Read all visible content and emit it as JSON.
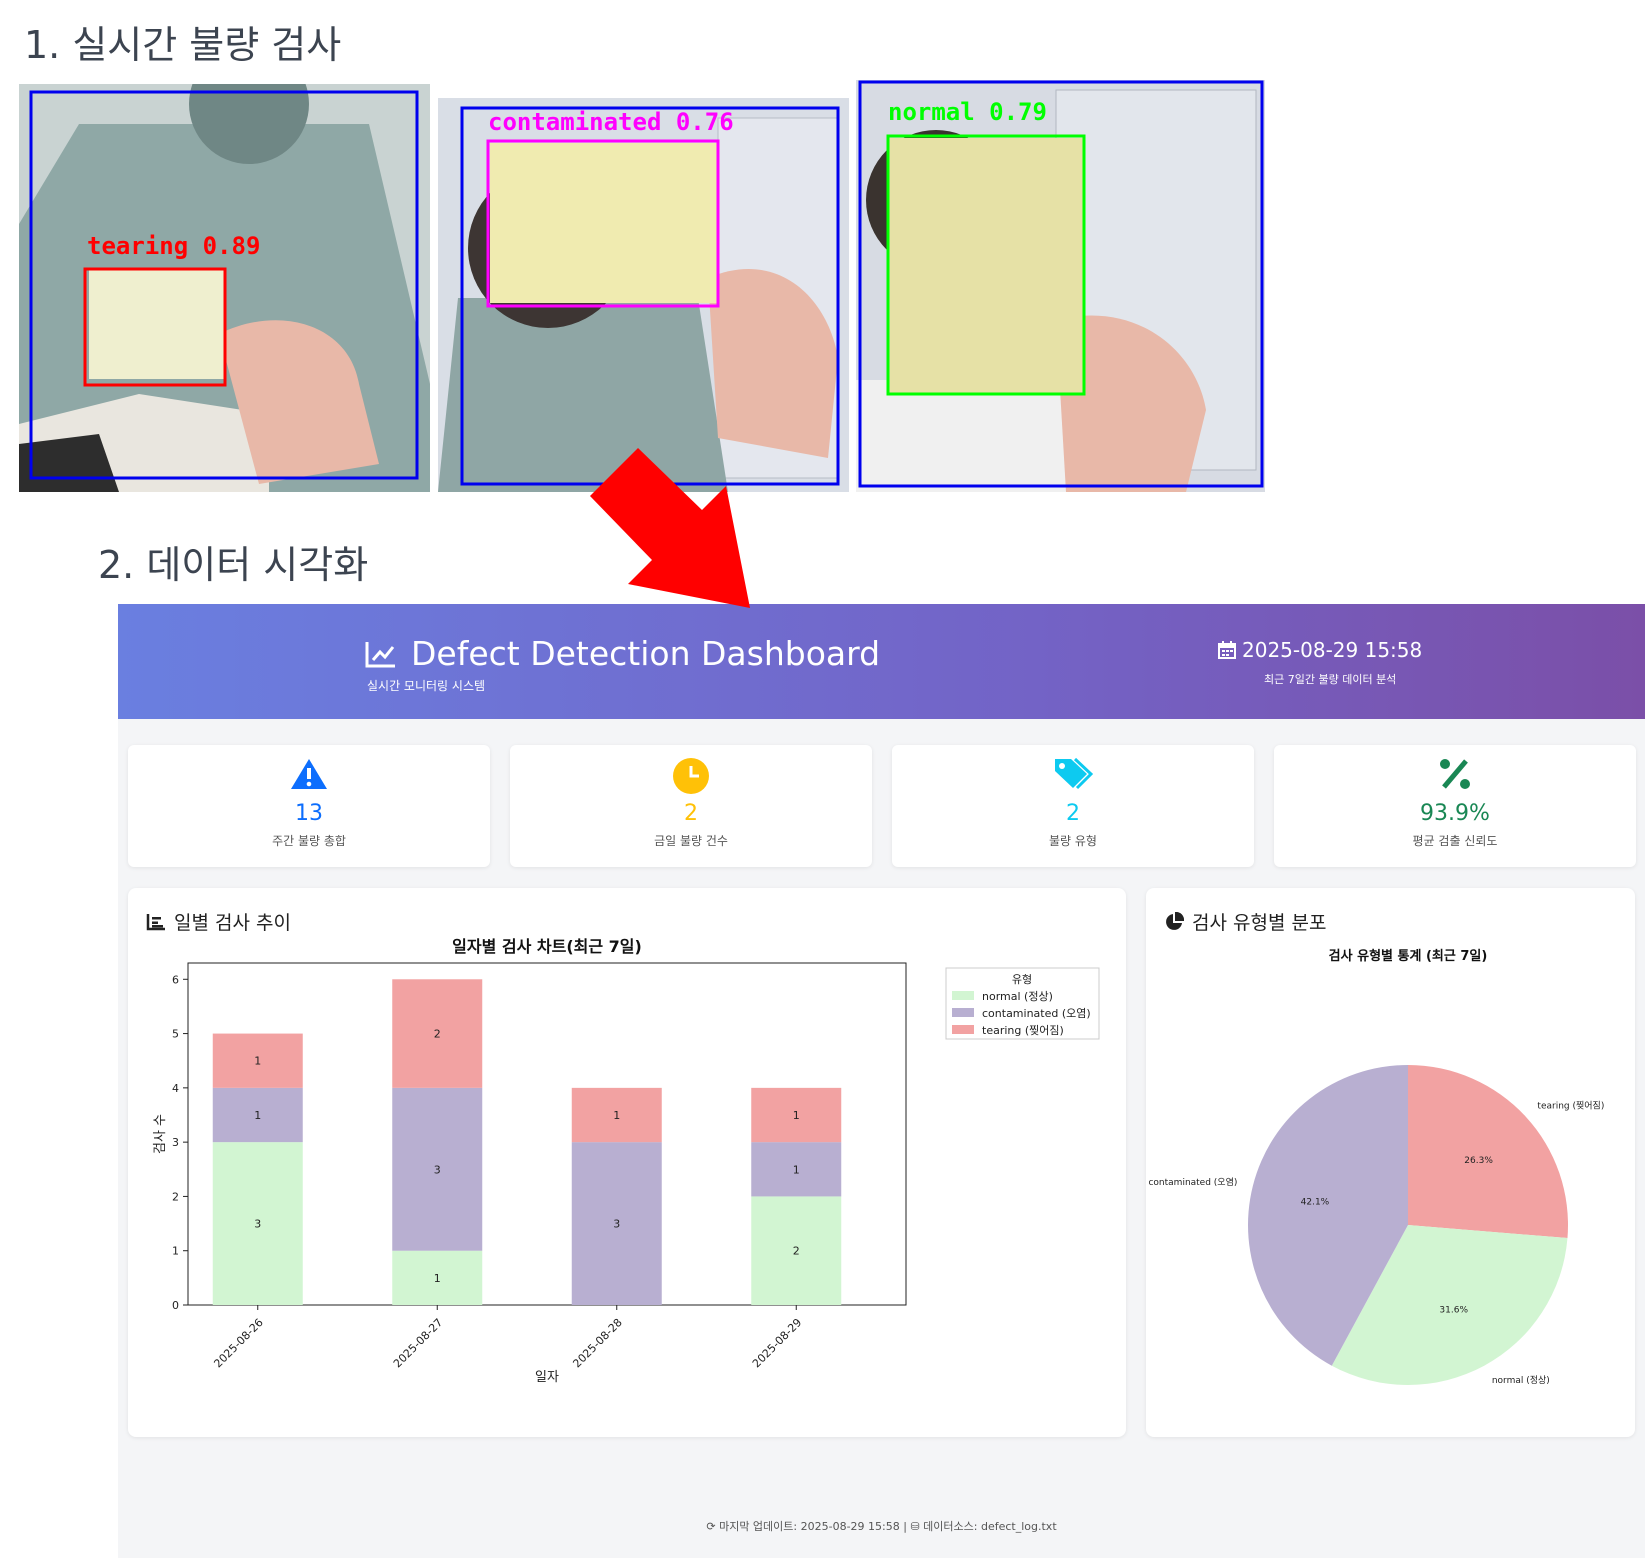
{
  "sections": {
    "realtime_title": "1. 실시간 불량 검사",
    "viz_title": "2. 데이터 시각화"
  },
  "detections": [
    {
      "label": "tearing 0.89",
      "color": "#ff0000"
    },
    {
      "label": "contaminated 0.76",
      "color": "#ff00ff"
    },
    {
      "label": "normal 0.79",
      "color": "#00ff00"
    }
  ],
  "header": {
    "title": "Defect Detection Dashboard",
    "subtitle": "실시간 모니터링 시스템",
    "datetime": "2025-08-29 15:58",
    "note": "최근 7일간 불량 데이터 분석"
  },
  "stats": [
    {
      "value": "13",
      "label": "주간 불량 총합",
      "color": "#0d6efd",
      "icon": "warning-icon"
    },
    {
      "value": "2",
      "label": "금일 불량 건수",
      "color": "#ffc107",
      "icon": "clock-icon"
    },
    {
      "value": "2",
      "label": "불량 유형",
      "color": "#0dcaf0",
      "icon": "tags-icon"
    },
    {
      "value": "93.9%",
      "label": "평균 검출 신뢰도",
      "color": "#198754",
      "icon": "percent-icon"
    }
  ],
  "panels": {
    "daily_title": "일별 검사 추이",
    "type_title": "검사 유형별 분포"
  },
  "chart_data": [
    {
      "type": "bar",
      "stacked": true,
      "title": "일자별 검사 차트(최근 7일)",
      "xlabel": "일자",
      "ylabel": "검사 수",
      "categories": [
        "2025-08-26",
        "2025-08-27",
        "2025-08-28",
        "2025-08-29"
      ],
      "series": [
        {
          "name": "normal (정상)",
          "values": [
            3,
            1,
            0,
            2
          ],
          "color": "#d2f5d2"
        },
        {
          "name": "contaminated (오염)",
          "values": [
            1,
            3,
            3,
            1
          ],
          "color": "#b8afd1"
        },
        {
          "name": "tearing (찢어짐)",
          "values": [
            1,
            2,
            1,
            1
          ],
          "color": "#f2a2a2"
        }
      ],
      "ylim": [
        0,
        6.3
      ],
      "yticks": [
        "0",
        "1",
        "2",
        "3",
        "4",
        "5",
        "6"
      ],
      "legend_title": "유형",
      "legend": "outside-right"
    },
    {
      "type": "pie",
      "title": "검사 유형별 통계 (최근 7일)",
      "slices": [
        {
          "name": "tearing (찢어짐)",
          "value": 26.3,
          "label": "26.3%",
          "color": "#f2a2a2"
        },
        {
          "name": "normal (정상)",
          "value": 31.6,
          "label": "31.6%",
          "color": "#d2f5d2"
        },
        {
          "name": "contaminated (오염)",
          "value": 42.1,
          "label": "42.1%",
          "color": "#b8afd1"
        }
      ]
    }
  ],
  "footer": {
    "text": "마지막 업데이트: 2025-08-29 15:58 | ",
    "source": "데이터소스: defect_log.txt"
  }
}
